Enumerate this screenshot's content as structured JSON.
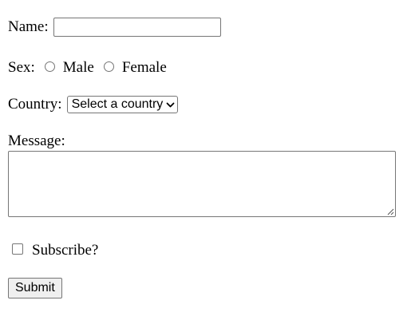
{
  "form": {
    "name": {
      "label": "Name:",
      "value": "",
      "placeholder": ""
    },
    "sex": {
      "label": "Sex:",
      "options": [
        {
          "label": "Male",
          "checked": false
        },
        {
          "label": "Female",
          "checked": false
        }
      ]
    },
    "country": {
      "label": "Country:",
      "selected": "Select a country",
      "icon": "chevron-down-icon"
    },
    "message": {
      "label": "Message:",
      "value": ""
    },
    "subscribe": {
      "label": "Subscribe?",
      "checked": false
    },
    "submit_label": "Submit"
  }
}
